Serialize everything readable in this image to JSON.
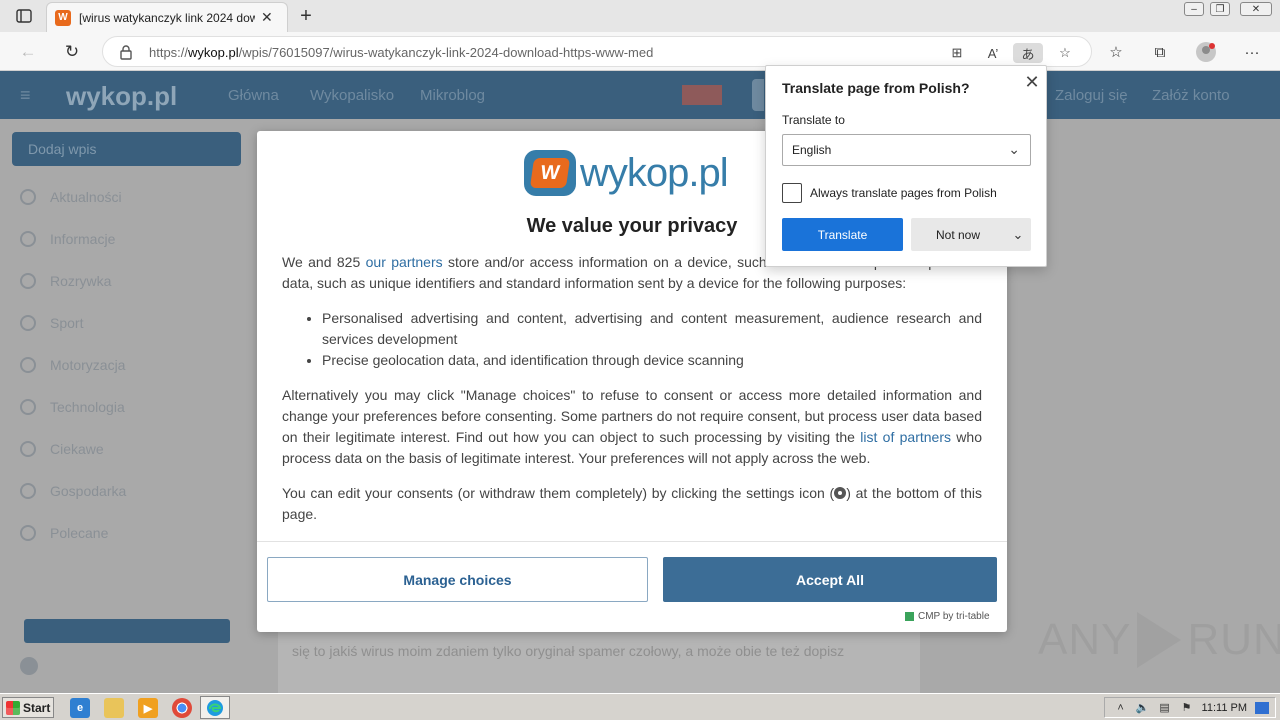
{
  "browser": {
    "tab_title": "[wirus watykanczyk link 2024 dow",
    "tab_favicon_text": "W",
    "url_prefix": "https://",
    "url_domain": "wykop.pl",
    "url_path": "/wpis/76015097/wirus-watykanczyk-link-2024-download-https-www-med",
    "translate_icon_text": "あ",
    "read_aloud_text": "A’"
  },
  "site": {
    "logo": "wykop.pl",
    "header_items": [
      "Główna",
      "Wykopalisko",
      "Mikroblog"
    ],
    "header_right": [
      "Zaloguj się",
      "Załóż konto"
    ],
    "add_button": "Dodaj wpis",
    "sidebar_items": [
      "Aktualności",
      "Informacje",
      "Rozrywka",
      "Sport",
      "Motoryzacja",
      "Technologia",
      "Ciekawe",
      "Gospodarka",
      "Polecane"
    ],
    "content_snippet": "się to jakiś wirus moim zdaniem tylko oryginał spamer czołowy, a może obie te też dopisz"
  },
  "consent": {
    "logo_text": "wykop.pl",
    "logo_badge": "W",
    "title": "We value your privacy",
    "p1_a": "We and 825 ",
    "p1_link": "our partners",
    "p1_b": " store and/or access information on a device, such as cookies and process personal data, such as unique identifiers and standard information sent by a device for the following purposes:",
    "purposes": [
      "Personalised advertising and content, advertising and content measurement, audience research and services development",
      "Precise geolocation data, and identification through device scanning"
    ],
    "p2_a": "Alternatively you may click \"Manage choices\" to refuse to consent or access more detailed information and change your preferences before consenting. Some partners do not require consent, but process user data based on their legitimate interest. Find out how you can object to such processing by visiting the ",
    "p2_link": "list of partners",
    "p2_b": " who process data on the basis of legitimate interest. Your preferences will not apply across the web.",
    "p3_a": "You can edit your consents (or withdraw them completely) by clicking the settings icon (",
    "p3_b": ") at the bottom of this page.",
    "manage_label": "Manage choices",
    "accept_label": "Accept All",
    "cmp_label": "CMP by tri-table"
  },
  "translate_popup": {
    "title": "Translate page from Polish?",
    "label": "Translate to",
    "selected_language": "English",
    "checkbox_label": "Always translate pages from Polish",
    "checkbox_checked": false,
    "translate_label": "Translate",
    "not_now_label": "Not now"
  },
  "watermark": {
    "left": "ANY",
    "right": "RUN"
  },
  "taskbar": {
    "start_label": "Start",
    "clock": "11:11 PM"
  }
}
